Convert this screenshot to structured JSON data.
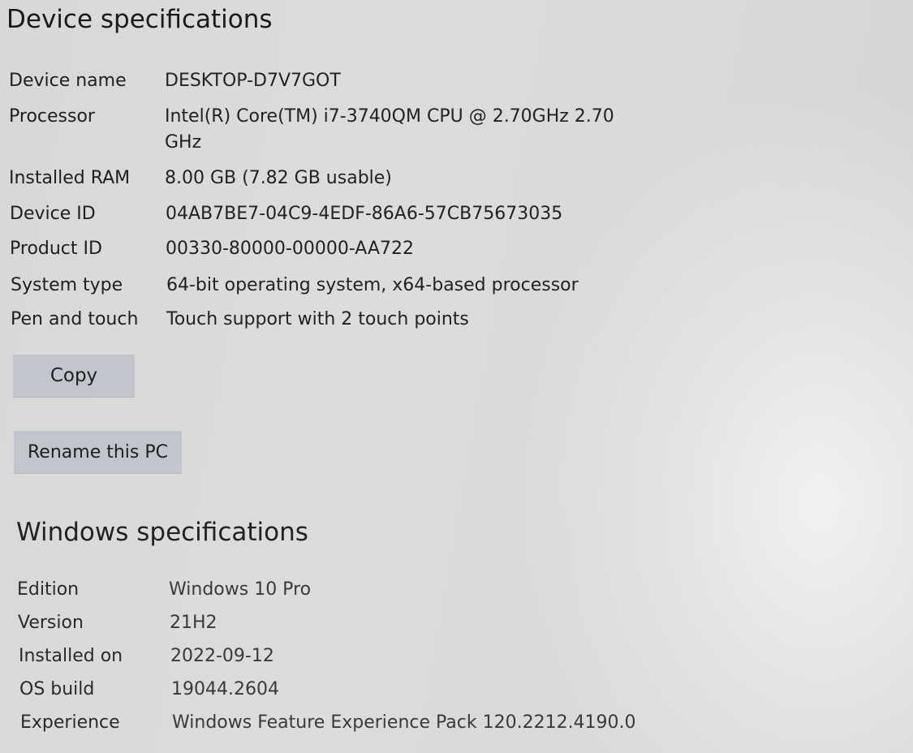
{
  "device": {
    "heading": "Device specifications",
    "rows": [
      {
        "label": "Device name",
        "value": "DESKTOP-D7V7GOT"
      },
      {
        "label": "Processor",
        "value": "Intel(R) Core(TM) i7-3740QM CPU @ 2.70GHz   2.70 GHz"
      },
      {
        "label": "Installed RAM",
        "value": "8.00 GB (7.82 GB usable)"
      },
      {
        "label": "Device ID",
        "value": "04AB7BE7-04C9-4EDF-86A6-57CB75673035"
      },
      {
        "label": "Product ID",
        "value": "00330-80000-00000-AA722"
      },
      {
        "label": "System type",
        "value": "64-bit operating system, x64-based processor"
      },
      {
        "label": "Pen and touch",
        "value": "Touch support with 2 touch points"
      }
    ],
    "copy_label": "Copy",
    "rename_label": "Rename this PC"
  },
  "windows": {
    "heading": "Windows specifications",
    "rows": [
      {
        "label": "Edition",
        "value": "Windows 10 Pro"
      },
      {
        "label": "Version",
        "value": "21H2"
      },
      {
        "label": "Installed on",
        "value": "2022-09-12"
      },
      {
        "label": "OS build",
        "value": "19044.2604"
      },
      {
        "label": "Experience",
        "value": "Windows Feature Experience Pack 120.2212.4190.0"
      }
    ]
  }
}
